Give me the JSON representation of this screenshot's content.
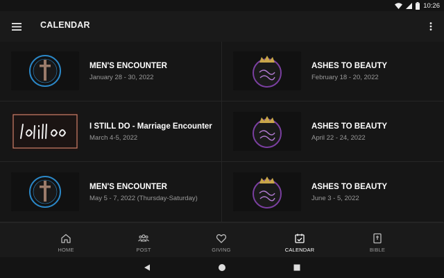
{
  "status": {
    "time": "10:26"
  },
  "appbar": {
    "title": "CALENDAR"
  },
  "events": [
    {
      "title": "MEN'S ENCOUNTER",
      "date": "January 28 - 30, 2022",
      "image": "cross-logo"
    },
    {
      "title": "ASHES TO BEAUTY",
      "date": "February 18 - 20, 2022",
      "image": "crown-logo"
    },
    {
      "title": "I STILL DO - Marriage Encounter",
      "date": "March 4-5, 2022",
      "image": "i-still-do-logo"
    },
    {
      "title": "ASHES TO BEAUTY",
      "date": "April 22 - 24, 2022",
      "image": "crown-logo"
    },
    {
      "title": "MEN'S ENCOUNTER",
      "date": "May 5 - 7, 2022 (Thursday-Saturday)",
      "image": "cross-logo"
    },
    {
      "title": "ASHES TO BEAUTY",
      "date": "June 3 - 5, 2022",
      "image": "crown-logo"
    }
  ],
  "nav": {
    "items": [
      {
        "label": "HOME",
        "icon": "home-icon"
      },
      {
        "label": "POST",
        "icon": "people-icon"
      },
      {
        "label": "GIVING",
        "icon": "heart-icon"
      },
      {
        "label": "CALENDAR",
        "icon": "calendar-icon",
        "active": true
      },
      {
        "label": "BIBLE",
        "icon": "bible-icon"
      }
    ]
  },
  "colors": {
    "background": "#141414",
    "card": "#161616",
    "text_secondary": "#9a9a9a",
    "crown_purple": "#7a3fa0",
    "cross_blue": "#2b88c8"
  }
}
